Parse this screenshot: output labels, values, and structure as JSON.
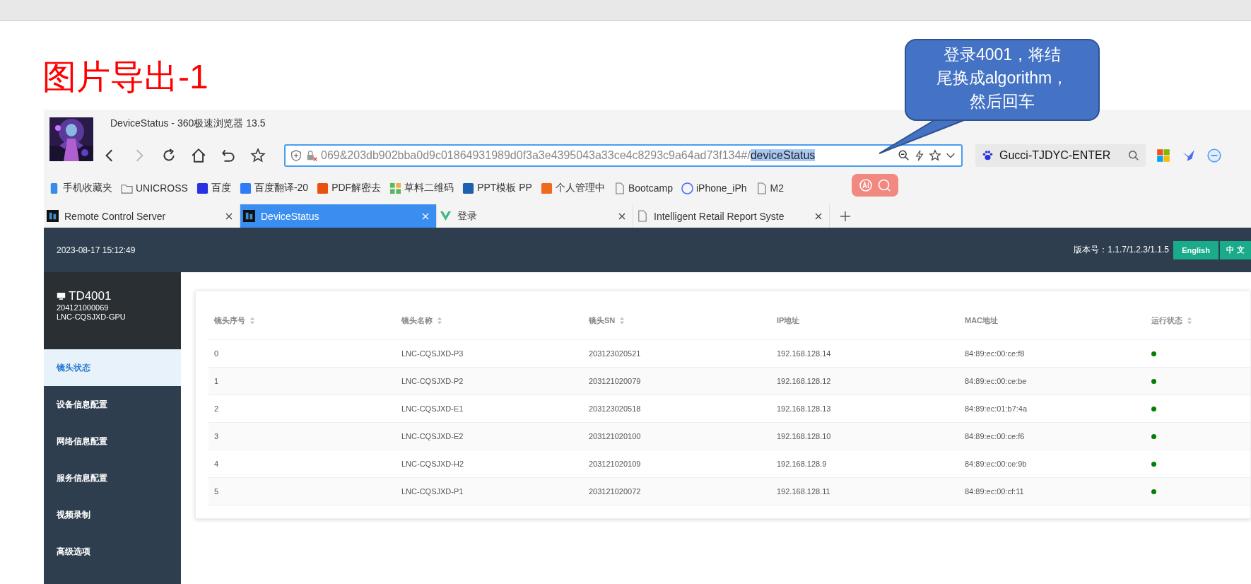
{
  "document_title": "图片导出-1",
  "callout": {
    "lines": [
      "登录4001，将结",
      "尾换成algorithm，",
      "然后回车"
    ]
  },
  "browser": {
    "title": "DeviceStatus - 360极速浏览器 13.5",
    "address": {
      "value": "069&203db902bba0d9c01864931989d0f3a3e4395043a33ce4c8293c9a64ad73f134#/",
      "selected_text": "deviceStatus"
    },
    "search": {
      "value": "Gucci-TJDYC-ENTER"
    },
    "bookmarks": [
      {
        "label": "手机收藏夹",
        "kind": "phone"
      },
      {
        "label": "UNICROSS",
        "kind": "folder"
      },
      {
        "label": "百度",
        "kind": "paw"
      },
      {
        "label": "百度翻译-20",
        "kind": "translate"
      },
      {
        "label": "PDF解密去",
        "kind": "pdf"
      },
      {
        "label": "草料二维码",
        "kind": "grid"
      },
      {
        "label": "PPT模板 PP",
        "kind": "ppt"
      },
      {
        "label": "个人管理中",
        "kind": "job"
      },
      {
        "label": "Bootcamp",
        "kind": "page"
      },
      {
        "label": "iPhone_iPh",
        "kind": "circle"
      },
      {
        "label": "M2",
        "kind": "page"
      }
    ],
    "tabs": [
      {
        "label": "Remote Control Server",
        "kind": "app",
        "selected": false
      },
      {
        "label": "DeviceStatus",
        "kind": "app",
        "selected": true
      },
      {
        "label": "登录",
        "kind": "vue",
        "selected": false
      },
      {
        "label": "Intelligent Retail Report Syste",
        "kind": "page",
        "selected": false
      }
    ]
  },
  "app": {
    "datetime": "2023-08-17 15:12:49",
    "version": "版本号：1.1.7/1.2.3/1.1.5",
    "language_buttons": [
      {
        "label": "English"
      },
      {
        "label": "中 文"
      }
    ],
    "device": {
      "name": "TD4001",
      "serial": "204121000069",
      "model": "LNC-CQSJXD-GPU"
    },
    "sidebar": {
      "items": [
        {
          "label": "镜头状态",
          "selected": true
        },
        {
          "label": "设备信息配置",
          "selected": false
        },
        {
          "label": "网络信息配置",
          "selected": false
        },
        {
          "label": "服务信息配置",
          "selected": false
        },
        {
          "label": "视频录制",
          "selected": false
        },
        {
          "label": "高级选项",
          "selected": false
        }
      ]
    },
    "table": {
      "columns": [
        {
          "label": "镜头序号",
          "sortable": true
        },
        {
          "label": "镜头名称",
          "sortable": true
        },
        {
          "label": "镜头SN",
          "sortable": true
        },
        {
          "label": "IP地址",
          "sortable": false
        },
        {
          "label": "MAC地址",
          "sortable": false
        },
        {
          "label": "运行状态",
          "sortable": true
        }
      ],
      "rows": [
        {
          "cells": [
            "0",
            "LNC-CQSJXD-P3",
            "203123020521",
            "192.168.128.14",
            "84:89:ec:00:ce:f8"
          ],
          "color": "#008000"
        },
        {
          "cells": [
            "1",
            "LNC-CQSJXD-P2",
            "203121020079",
            "192.168.128.12",
            "84:89:ec:00:ce:be"
          ],
          "color": "#008000"
        },
        {
          "cells": [
            "2",
            "LNC-CQSJXD-E1",
            "203123020518",
            "192.168.128.13",
            "84:89:ec:01:b7:4a"
          ],
          "color": "#008000"
        },
        {
          "cells": [
            "3",
            "LNC-CQSJXD-E2",
            "203121020100",
            "192.168.128.10",
            "84:89:ec:00:ce:f6"
          ],
          "color": "#008000"
        },
        {
          "cells": [
            "4",
            "LNC-CQSJXD-H2",
            "203121020109",
            "192.168.128.9",
            "84:89:ec:00:ce:9b"
          ],
          "color": "#008000"
        },
        {
          "cells": [
            "5",
            "LNC-CQSJXD-P1",
            "203121020072",
            "192.168.128.11",
            "84:89:ec:00:cf:11"
          ],
          "color": "#008000"
        }
      ]
    }
  }
}
